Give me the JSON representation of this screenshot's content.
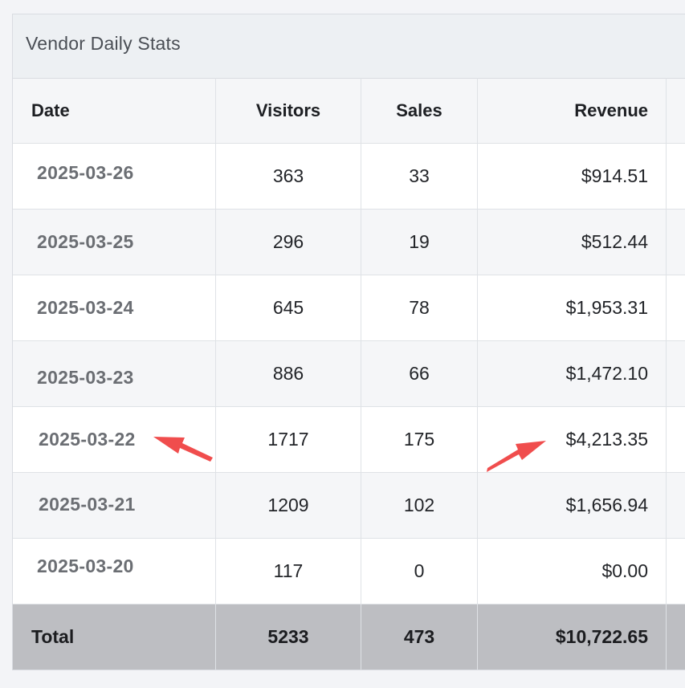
{
  "panel": {
    "title": "Vendor Daily Stats"
  },
  "table": {
    "headers": {
      "date": "Date",
      "visitors": "Visitors",
      "sales": "Sales",
      "revenue": "Revenue"
    },
    "rows": [
      {
        "date": "2025-03-26",
        "visitors": "363",
        "sales": "33",
        "revenue": "$914.51"
      },
      {
        "date": "2025-03-25",
        "visitors": "296",
        "sales": "19",
        "revenue": "$512.44"
      },
      {
        "date": "2025-03-24",
        "visitors": "645",
        "sales": "78",
        "revenue": "$1,953.31"
      },
      {
        "date": "2025-03-23",
        "visitors": "886",
        "sales": "66",
        "revenue": "$1,472.10"
      },
      {
        "date": "2025-03-22",
        "visitors": "1717",
        "sales": "175",
        "revenue": "$4,213.35"
      },
      {
        "date": "2025-03-21",
        "visitors": "1209",
        "sales": "102",
        "revenue": "$1,656.94"
      },
      {
        "date": "2025-03-20",
        "visitors": "117",
        "sales": "0",
        "revenue": "$0.00"
      }
    ],
    "total": {
      "label": "Total",
      "visitors": "5233",
      "sales": "473",
      "revenue": "$10,722.65"
    }
  },
  "annotations": {
    "arrow_color": "#f04d4d",
    "icons": [
      "annotation-arrow-icon",
      "annotation-arrow-icon"
    ]
  },
  "colors": {
    "header_bg": "#edf0f3",
    "total_bg": "#bdbec2",
    "date_text": "#6b6e73"
  }
}
